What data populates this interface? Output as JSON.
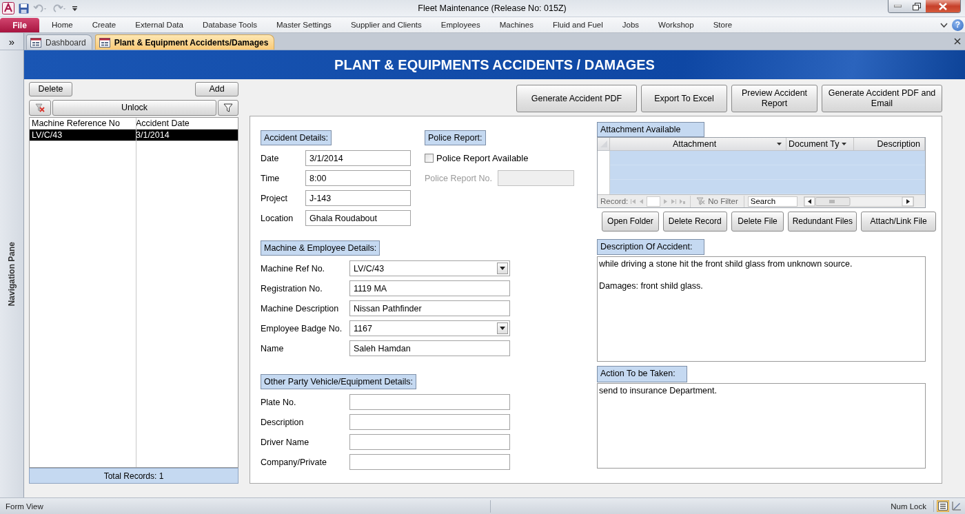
{
  "window": {
    "title": "Fleet Maintenance (Release No: 015Z)"
  },
  "ribbon": {
    "file_tab": "File",
    "tabs": [
      "Home",
      "Create",
      "External Data",
      "Database Tools",
      "Master Settings",
      "Supplier and Clients",
      "Employees",
      "Machines",
      "Fluid and Fuel",
      "Jobs",
      "Workshop",
      "Store"
    ],
    "help": "?"
  },
  "navigation_pane": {
    "toggle": "»",
    "label": "Navigation Pane"
  },
  "document_tabs": [
    {
      "label": "Dashboard",
      "selected": false
    },
    {
      "label": "Plant & Equipment Accidents/Damages",
      "selected": true
    }
  ],
  "form": {
    "header": "PLANT & EQUIPMENTS ACCIDENTS / DAMAGES",
    "list_panel": {
      "buttons": [
        "Delete",
        "Add"
      ],
      "unlock": "Unlock",
      "columns": [
        "Machine Reference No",
        "Accident Date"
      ],
      "rows": [
        {
          "cells": [
            "LV/C/43",
            "3/1/2014"
          ],
          "selected": true
        }
      ],
      "total": "Total Records: 1"
    },
    "actions": [
      "Generate Accident PDF",
      "Export To Excel",
      "Preview Accident Report",
      "Generate Accident PDF and Email"
    ],
    "accident_details": {
      "title": "Accident Details:",
      "fields": [
        {
          "label": "Date",
          "value": "3/1/2014"
        },
        {
          "label": "Time",
          "value": "8:00"
        },
        {
          "label": "Project",
          "value": "J-143"
        },
        {
          "label": "Location",
          "value": "Ghala Roudabout"
        }
      ]
    },
    "police_report": {
      "title": "Police Report:",
      "checkbox": {
        "label": "Police Report Available",
        "checked": false
      },
      "field": {
        "label": "Police Report No.",
        "disabled": true
      }
    },
    "machine_employee": {
      "title": "Machine & Employee Details:",
      "fields": [
        {
          "label": "Machine Ref No.",
          "value": "LV/C/43",
          "kind": "combo"
        },
        {
          "label": "Registration No.",
          "value": "1119 MA",
          "kind": "text"
        },
        {
          "label": "Machine Description",
          "value": "Nissan Pathfinder",
          "kind": "text"
        },
        {
          "label": "Employee Badge No.",
          "value": "1167",
          "kind": "combo"
        },
        {
          "label": "Name",
          "value": "Saleh Hamdan",
          "kind": "text"
        }
      ]
    },
    "other_party": {
      "title": "Other Party Vehicle/Equipment Details:",
      "fields": [
        {
          "label": "Plate No."
        },
        {
          "label": "Description"
        },
        {
          "label": "Driver Name"
        },
        {
          "label": "Company/Private"
        }
      ]
    },
    "attachments": {
      "title": "Attachment Available",
      "columns": [
        "Attachment",
        "Document Ty",
        "Description"
      ],
      "navigator": {
        "record_label": "Record:",
        "filter": "No Filter",
        "search_placeholder": "Search"
      },
      "buttons": [
        "Open Folder",
        "Delete Record",
        "Delete File",
        "Redundant Files",
        "Attach/Link File"
      ]
    },
    "description": {
      "title": "Description Of Accident:",
      "paragraphs": [
        "while driving a stone hit the front shild glass from unknown source.",
        "Damages: front shild glass."
      ]
    },
    "action": {
      "title": "Action To be Taken:",
      "text": "send to insurance Department."
    }
  },
  "status_bar": {
    "view": "Form View",
    "num_lock": "Num Lock"
  }
}
